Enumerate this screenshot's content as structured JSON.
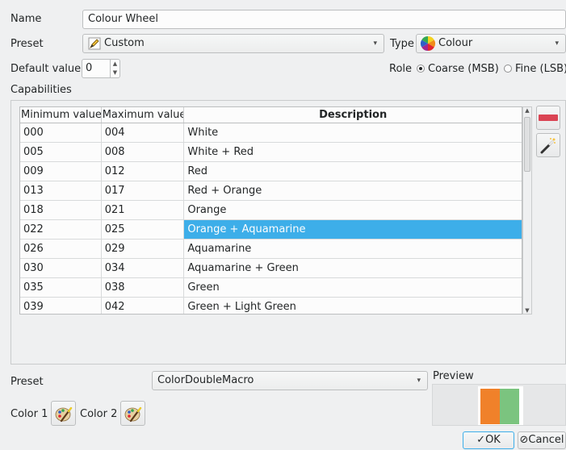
{
  "form": {
    "name_label": "Name",
    "name_value": "Colour Wheel",
    "preset_label": "Preset",
    "preset_value": "Custom",
    "type_label": "Type",
    "type_value": "Colour",
    "default_label": "Default value",
    "default_value": "0",
    "role_label": "Role",
    "role_options": [
      "Coarse (MSB)",
      "Fine (LSB)"
    ],
    "role_selected": "Coarse (MSB)",
    "capabilities_label": "Capabilities"
  },
  "table": {
    "headers": [
      "Minimum value",
      "Maximum value",
      "Description"
    ],
    "rows": [
      [
        "000",
        "004",
        "White"
      ],
      [
        "005",
        "008",
        "White + Red"
      ],
      [
        "009",
        "012",
        "Red"
      ],
      [
        "013",
        "017",
        "Red + Orange"
      ],
      [
        "018",
        "021",
        "Orange"
      ],
      [
        "022",
        "025",
        "Orange + Aquamarine"
      ],
      [
        "026",
        "029",
        "Aquamarine"
      ],
      [
        "030",
        "034",
        "Aquamarine + Green"
      ],
      [
        "035",
        "038",
        "Green"
      ],
      [
        "039",
        "042",
        "Green + Light Green"
      ]
    ],
    "selected_row": 5
  },
  "capability": {
    "preset_label": "Preset",
    "preset_value": "ColorDoubleMacro",
    "color1_label": "Color 1",
    "color2_label": "Color 2",
    "preview_label": "Preview",
    "preview_colors": [
      "#f0812a",
      "#7bc47f"
    ]
  },
  "buttons": {
    "ok": "OK",
    "cancel": "Cancel"
  },
  "icons": {
    "preset": "pencil-icon",
    "type": "colour-wheel-icon",
    "remove": "remove-icon",
    "wizard": "magic-wand-icon",
    "color_picker": "palette-brush-icon"
  },
  "colors": {
    "selection": "#3daee9",
    "background": "#eff0f1"
  }
}
